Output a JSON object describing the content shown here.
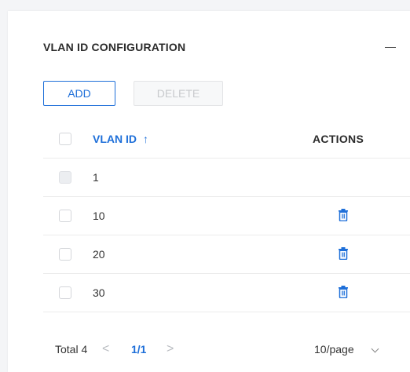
{
  "section": {
    "title": "VLAN ID CONFIGURATION",
    "collapse_icon": "minus-icon"
  },
  "toolbar": {
    "add_label": "ADD",
    "delete_label": "DELETE"
  },
  "table": {
    "columns": {
      "vlan_id": "VLAN ID",
      "sort_indicator": "↑",
      "actions": "ACTIONS"
    },
    "rows": [
      {
        "vlan_id": "1",
        "checkbox_disabled": true,
        "has_delete": false
      },
      {
        "vlan_id": "10",
        "checkbox_disabled": false,
        "has_delete": true
      },
      {
        "vlan_id": "20",
        "checkbox_disabled": false,
        "has_delete": true
      },
      {
        "vlan_id": "30",
        "checkbox_disabled": false,
        "has_delete": true
      }
    ],
    "row_action_icon": "trash-icon"
  },
  "pagination": {
    "total_text": "Total 4",
    "prev_glyph": "<",
    "page_info": "1/1",
    "next_glyph": ">",
    "page_size": "10/page"
  },
  "colors": {
    "accent": "#1e6fd9",
    "disabled_text": "#c8cacd",
    "border": "#ececec"
  }
}
